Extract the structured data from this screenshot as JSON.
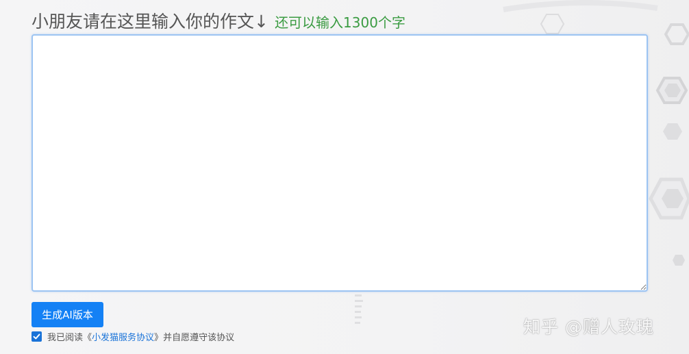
{
  "header": {
    "title": "小朋友请在这里输入你的作文",
    "arrow": "↓",
    "remaining": "还可以输入1300个字"
  },
  "essay": {
    "value": "",
    "placeholder": ""
  },
  "actions": {
    "generate_label": "生成AI版本"
  },
  "agreement": {
    "checked": true,
    "prefix": "我已阅读",
    "open_quote": "《",
    "link": "小发猫服务协议",
    "close_quote": "》",
    "suffix": "并自愿遵守该协议"
  },
  "watermark": {
    "text": "知乎 @赠人玫瑰"
  },
  "colors": {
    "accent": "#1481f5",
    "remaining_text": "#3a9b41",
    "link": "#1a73d8"
  }
}
